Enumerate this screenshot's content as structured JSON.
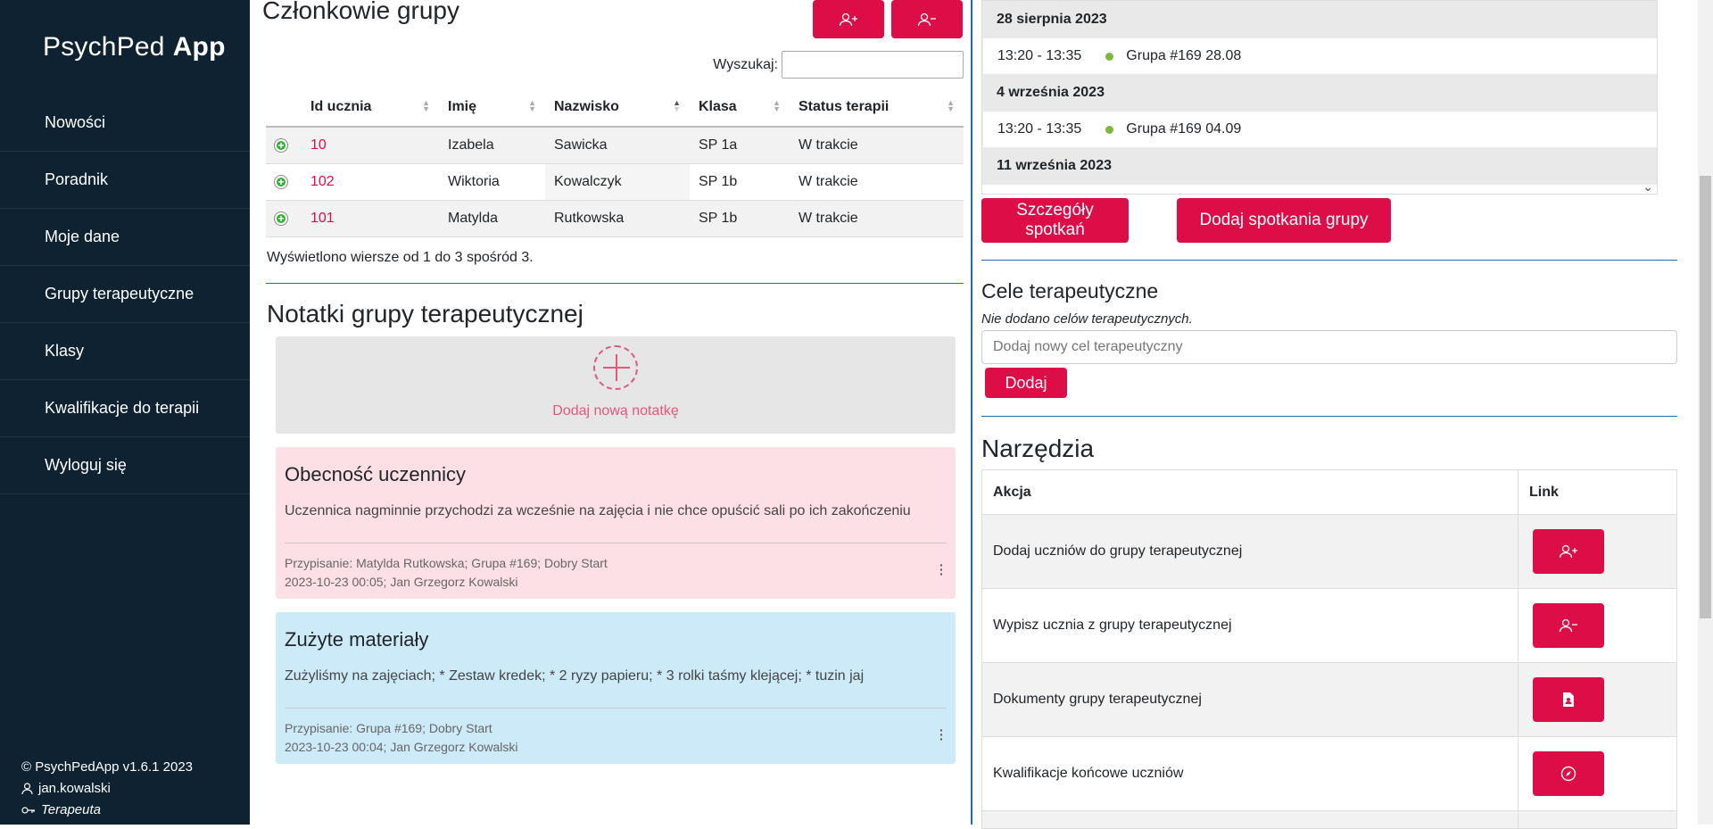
{
  "sidebar": {
    "brand_light": "PsychPed",
    "brand_bold": "App",
    "items": [
      {
        "label": "Nowości"
      },
      {
        "label": "Poradnik"
      },
      {
        "label": "Moje dane"
      },
      {
        "label": "Grupy terapeutyczne"
      },
      {
        "label": "Klasy"
      },
      {
        "label": "Kwalifikacje do terapii"
      },
      {
        "label": "Wyloguj się"
      }
    ],
    "footer": {
      "version": "© PsychPedApp v1.6.1 2023",
      "user": "jan.kowalski",
      "role": "Terapeuta"
    }
  },
  "members": {
    "title": "Członkowie grupy",
    "search_label": "Wyszukaj:",
    "columns": [
      "Id ucznia",
      "Imię",
      "Nazwisko",
      "Klasa",
      "Status terapii"
    ],
    "rows": [
      {
        "id": "10",
        "first": "Izabela",
        "last": "Sawicka",
        "class": "SP 1a",
        "status": "W trakcie"
      },
      {
        "id": "102",
        "first": "Wiktoria",
        "last": "Kowalczyk",
        "class": "SP 1b",
        "status": "W trakcie"
      },
      {
        "id": "101",
        "first": "Matylda",
        "last": "Rutkowska",
        "class": "SP 1b",
        "status": "W trakcie"
      }
    ],
    "info": "Wyświetlono wiersze od 1 do 3 spośród 3."
  },
  "notes": {
    "title": "Notatki grupy terapeutycznej",
    "add_label": "Dodaj nową notatkę",
    "items": [
      {
        "title": "Obecność uczennicy",
        "body": "Uczennica nagminnie przychodzi za wcześnie na zajęcia i nie chce opuścić sali po ich zakończeniu",
        "assignment": "Przypisanie: Matylda Rutkowska; Grupa #169; Dobry Start",
        "stamp": "2023-10-23 00:05; Jan Grzegorz Kowalski",
        "color": "#fde0e6"
      },
      {
        "title": "Zużyte materiały",
        "body": "Zużyliśmy na zajęciach; * Zestaw kredek; * 2 ryzy papieru; * 3 rolki taśmy klejącej; * tuzin jaj",
        "assignment": "Przypisanie: Grupa #169; Dobry Start",
        "stamp": "2023-10-23 00:04; Jan Grzegorz Kowalski",
        "color": "#cdeaf8"
      }
    ]
  },
  "meetings": {
    "groups": [
      {
        "date": "28 sierpnia 2023",
        "time": "13:20 - 13:35",
        "group": "Grupa #169 28.08"
      },
      {
        "date": "4 września 2023",
        "time": "13:20 - 13:35",
        "group": "Grupa #169 04.09"
      },
      {
        "date": "11 września 2023"
      }
    ],
    "details_button": "Szczegóły spotkań",
    "add_button": "Dodaj spotkania grupy"
  },
  "goals": {
    "title": "Cele terapeutyczne",
    "empty": "Nie dodano celów terapeutycznych.",
    "placeholder": "Dodaj nowy cel terapeutyczny",
    "add_button": "Dodaj"
  },
  "tools": {
    "title": "Narzędzia",
    "col_action": "Akcja",
    "col_link": "Link",
    "rows": [
      {
        "action": "Dodaj uczniów do grupy terapeutycznej",
        "icon": "user-plus-icon"
      },
      {
        "action": "Wypisz ucznia z grupy terapeutycznej",
        "icon": "user-minus-icon"
      },
      {
        "action": "Dokumenty grupy terapeutycznej",
        "icon": "document-icon"
      },
      {
        "action": "Kwalifikacje końcowe uczniów",
        "icon": "compass-icon"
      }
    ]
  },
  "colors": {
    "accent": "#dc0d47",
    "sidebar": "#0f2231",
    "divider": "#1c6fb5"
  }
}
